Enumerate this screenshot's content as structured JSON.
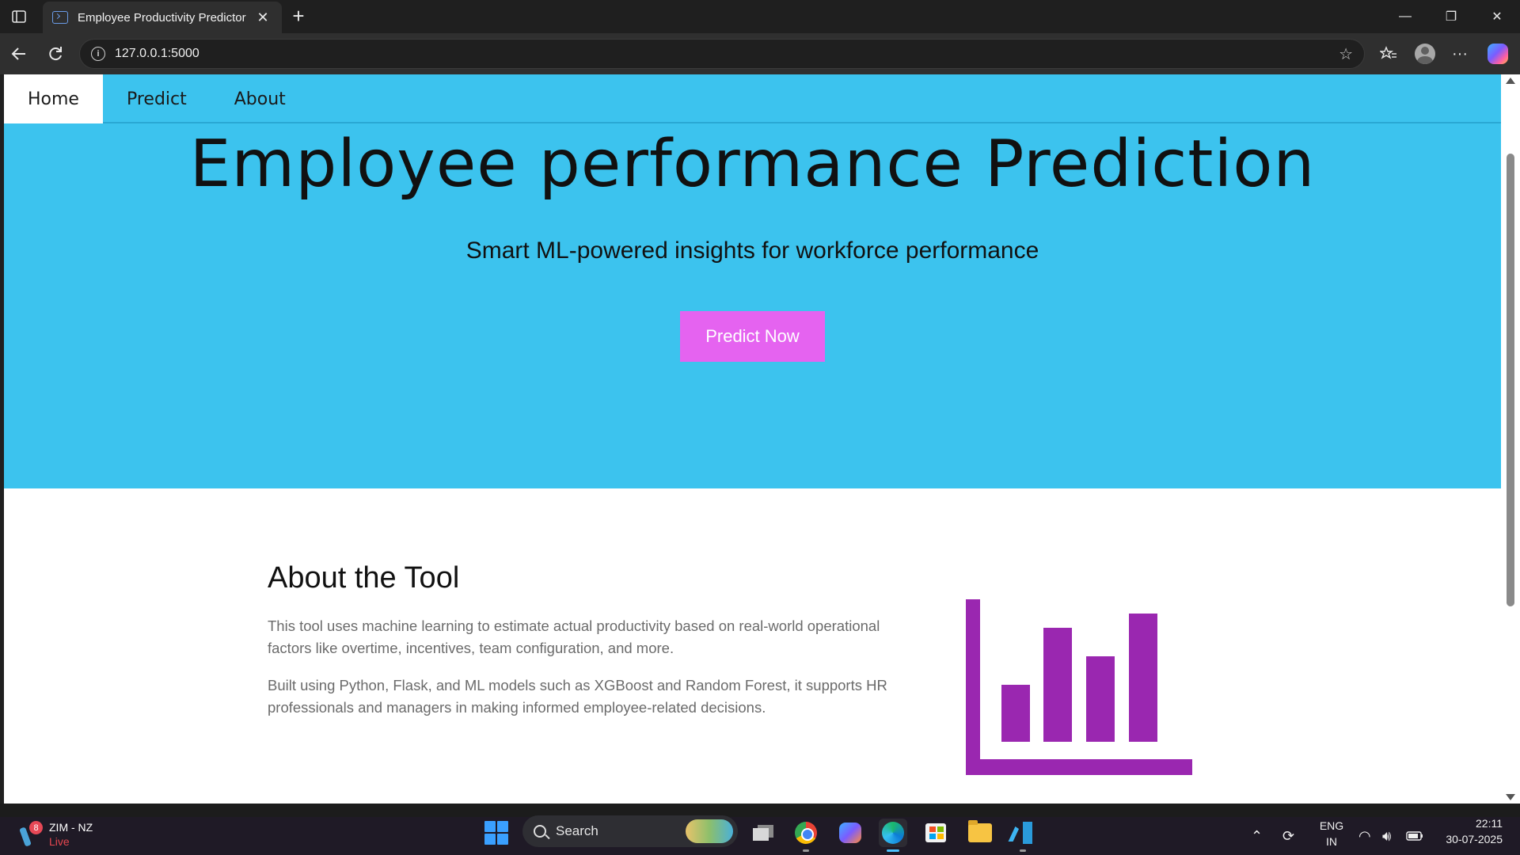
{
  "browser": {
    "tab_title": "Employee Productivity Predictor",
    "url": "127.0.0.1:5000"
  },
  "site": {
    "nav": [
      {
        "label": "Home",
        "active": true
      },
      {
        "label": "Predict",
        "active": false
      },
      {
        "label": "About",
        "active": false
      }
    ],
    "hero": {
      "title": "Employee performance Prediction",
      "subtitle": "Smart ML-powered insights for workforce performance",
      "cta_label": "Predict Now"
    },
    "about": {
      "heading": "About the Tool",
      "paragraph1": "This tool uses machine learning to estimate actual productivity based on real-world operational factors like overtime, incentives, team configuration, and more.",
      "paragraph2": "Built using Python, Flask, and ML models such as XGBoost and Random Forest, it supports HR professionals and managers in making informed employee-related decisions.",
      "illustration_icon": "bar-chart-icon",
      "illustration_color": "#9a27b0"
    },
    "colors": {
      "accent": "#3cc3ee",
      "cta": "#e563f0"
    }
  },
  "taskbar": {
    "widget_title": "ZIM - NZ",
    "widget_status": "Live",
    "widget_badge": "8",
    "search_placeholder": "Search",
    "lang_line1": "ENG",
    "lang_line2": "IN",
    "time": "22:11",
    "date": "30-07-2025"
  }
}
